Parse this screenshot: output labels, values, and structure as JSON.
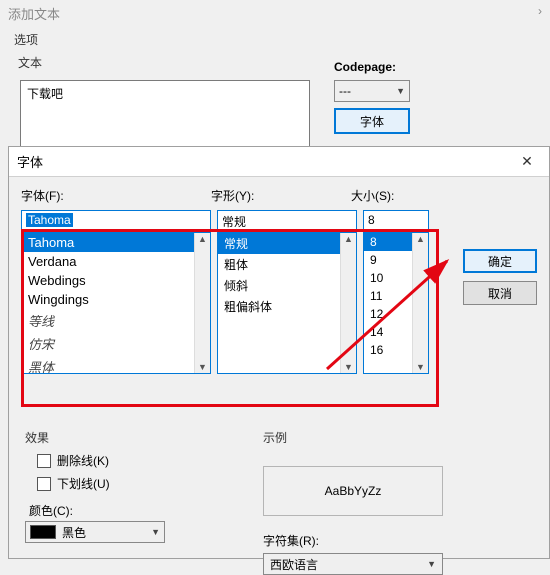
{
  "outer": {
    "title": "添加文本",
    "chevron": "›",
    "options_label": "选项",
    "text_label": "文本",
    "codepage_label": "Codepage:",
    "textarea_value": "下载吧",
    "codepage_value": "---",
    "font_button": "字体"
  },
  "dialog": {
    "title": "字体",
    "close": "✕",
    "labels": {
      "font": "字体(F):",
      "style": "字形(Y):",
      "size": "大小(S):"
    },
    "font_input": "Tahoma",
    "font_list": [
      "Tahoma",
      "Verdana",
      "Webdings",
      "Wingdings",
      "等线",
      "仿宋",
      "黑体"
    ],
    "font_selected_index": 0,
    "style_input": "常规",
    "style_list": [
      "常规",
      "粗体",
      "倾斜",
      "粗偏斜体"
    ],
    "style_selected_index": 0,
    "size_input": "8",
    "size_list": [
      "8",
      "9",
      "10",
      "11",
      "12",
      "14",
      "16"
    ],
    "size_selected_index": 0,
    "ok": "确定",
    "cancel": "取消",
    "effects_label": "效果",
    "strikeout": "删除线(K)",
    "underline": "下划线(U)",
    "color_label": "颜色(C):",
    "color_value": "黑色",
    "sample_label": "示例",
    "sample_text": "AaBbYyZz",
    "charset_label": "字符集(R):",
    "charset_value": "西欧语言"
  }
}
